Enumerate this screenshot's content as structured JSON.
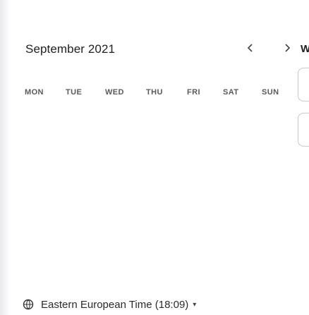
{
  "calendar": {
    "month_title": "September 2021",
    "prev_icon": "chevron-left-icon",
    "next_icon": "chevron-right-icon",
    "weekdays": [
      "MON",
      "TUE",
      "WED",
      "THU",
      "FRI",
      "SAT",
      "SUN"
    ]
  },
  "timezone": {
    "icon": "globe-icon",
    "label": "Eastern European Time (18:09)",
    "caret": "▾"
  },
  "side_panel": {
    "label": "W"
  }
}
